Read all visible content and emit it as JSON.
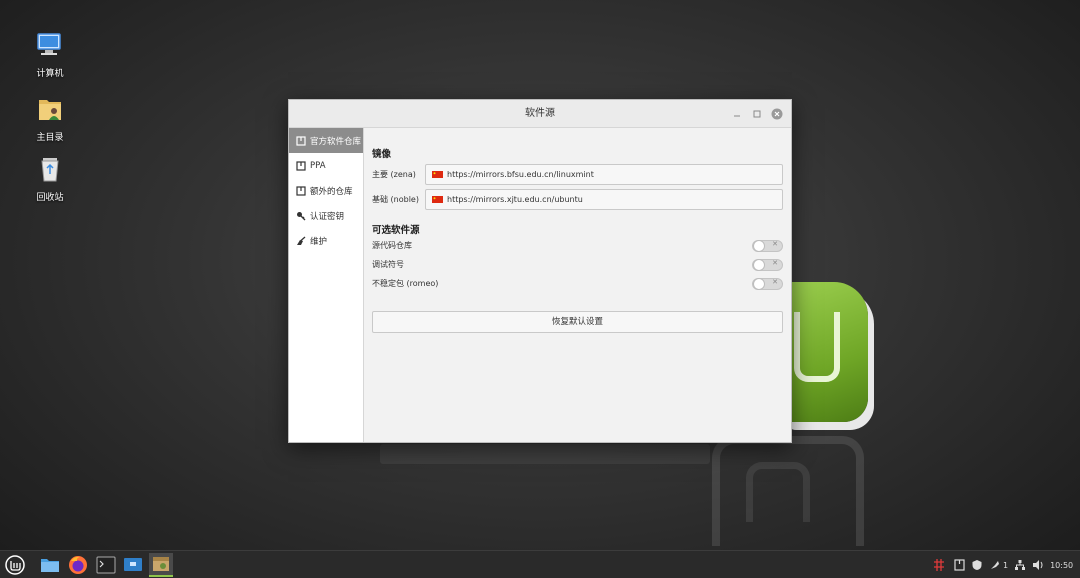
{
  "desktop": {
    "icons": [
      {
        "label": "计算机"
      },
      {
        "label": "主目录"
      },
      {
        "label": "回收站"
      }
    ]
  },
  "window": {
    "title": "软件源",
    "sidebar": {
      "items": [
        {
          "label": "官方软件仓库",
          "active": true
        },
        {
          "label": "PPA"
        },
        {
          "label": "额外的仓库"
        },
        {
          "label": "认证密钥"
        },
        {
          "label": "维护"
        }
      ]
    },
    "mirrors": {
      "title": "镜像",
      "rows": [
        {
          "label": "主要 (zena)",
          "url": "https://mirrors.bfsu.edu.cn/linuxmint"
        },
        {
          "label": "基础 (noble)",
          "url": "https://mirrors.xjtu.edu.cn/ubuntu"
        }
      ]
    },
    "optional": {
      "title": "可选软件源",
      "rows": [
        {
          "label": "源代码仓库",
          "enabled": false
        },
        {
          "label": "调试符号",
          "enabled": false
        },
        {
          "label": "不稳定包 (romeo)",
          "enabled": false
        }
      ]
    },
    "restore_label": "恢复默认设置"
  },
  "taskbar": {
    "tray": {
      "updates_count": "1",
      "time": "10:50"
    }
  },
  "colors": {
    "accent": "#8fc54b",
    "flag_red": "#de2910",
    "flag_yellow": "#ffde00"
  }
}
